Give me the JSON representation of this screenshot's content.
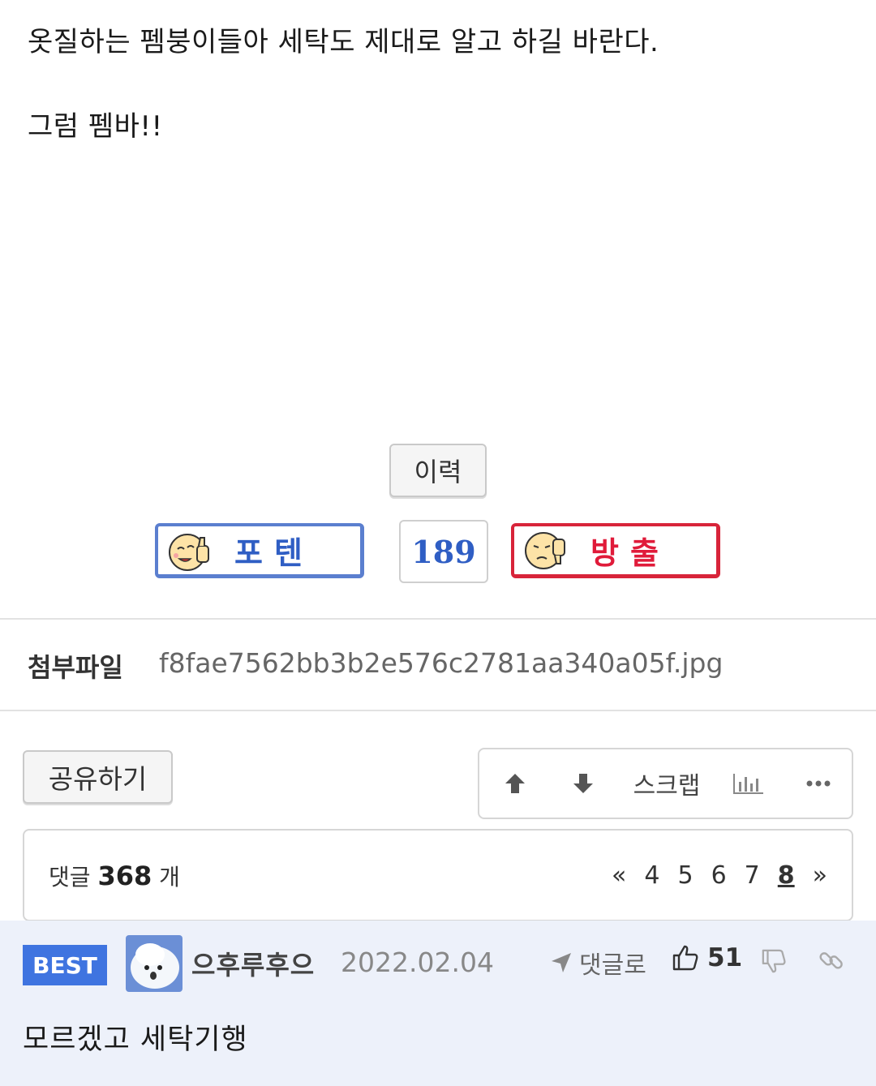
{
  "post": {
    "line1": "옷질하는 펨붕이들아 세탁도 제대로 알고 하길 바란다.",
    "line2": "그럼 펨바!!"
  },
  "history_label": "이력",
  "votes": {
    "up_label": "포텐",
    "count": "189",
    "down_label": "방출",
    "up_color": "#2f5ec4",
    "down_color": "#e01b3a"
  },
  "attachment": {
    "label": "첨부파일",
    "filename": "f8fae7562bb3b2e576c2781aa340a05f.jpg"
  },
  "actions": {
    "share_label": "공유하기",
    "scrap_label": "스크랩",
    "icons": [
      "arrow-up-icon",
      "arrow-down-icon",
      "stats-icon",
      "more-icon"
    ]
  },
  "comments": {
    "prefix": "댓글",
    "count": "368",
    "suffix": "개",
    "pages": {
      "first": "«",
      "p4": "4",
      "p5": "5",
      "p6": "6",
      "p7": "7",
      "current": "8",
      "last": "»"
    }
  },
  "best_comment": {
    "badge": "BEST",
    "user": "으후루후으",
    "date": "2022.02.04",
    "reply_label": "댓글로",
    "likes": "51",
    "text": "모르겠고 세탁기행",
    "highlight_color": "#3f74e0"
  }
}
